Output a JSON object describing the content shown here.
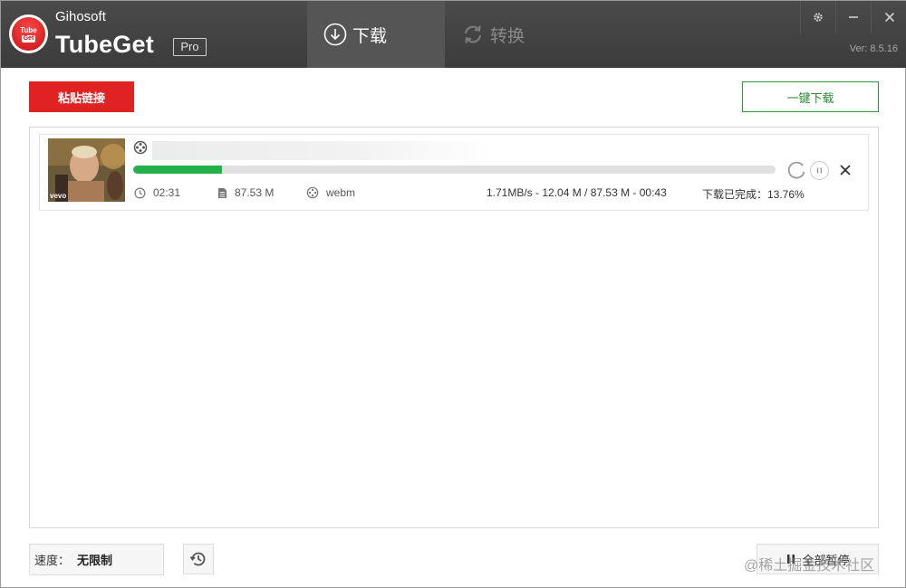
{
  "app": {
    "brand_small": "Gihosoft",
    "brand_big": "TubeGet",
    "edition": "Pro",
    "version": "Ver: 8.5.16",
    "logo_text_top": "Tube",
    "logo_text_bottom": "Get",
    "colors": {
      "titlebar": "#3f3f3f",
      "accent_red": "#e02222",
      "accent_green": "#22b04b"
    }
  },
  "tabs": [
    {
      "label": "下载",
      "icon": "download-circle-icon",
      "active": true
    },
    {
      "label": "转换",
      "icon": "convert-arrows-icon",
      "active": false
    }
  ],
  "window_controls": [
    "gear-icon",
    "minimize-icon",
    "close-icon"
  ],
  "toolbar": {
    "paste_label": "粘贴链接",
    "onekey_label": "一键下载"
  },
  "downloads": [
    {
      "thumb_badge": "vevo",
      "title": "",
      "progress_percent": 13.76,
      "duration": "02:31",
      "size": "87.53 M",
      "format": "webm",
      "stats": "1.71MB/s - 12.04 M / 87.53 M - 00:43",
      "done_text": "下载已完成：13.76%"
    }
  ],
  "footer": {
    "speed_label": "速度：",
    "speed_value": "无限制",
    "pause_all_label": "全部暂停",
    "watermark": "@稀土掘金技术社区"
  }
}
